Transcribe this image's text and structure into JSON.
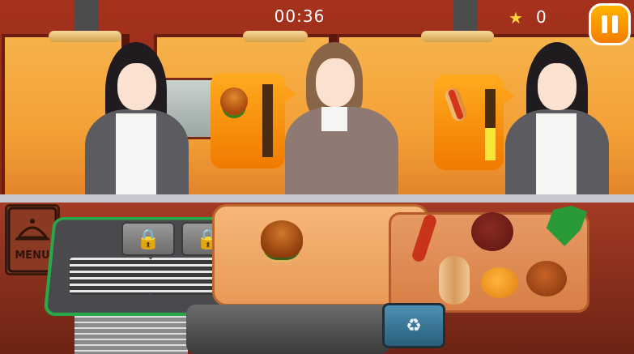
{
  "hud": {
    "timer": "00:36",
    "score": "0",
    "star_icon": "star-icon",
    "pause_icon": "pause-icon"
  },
  "menu": {
    "label": "MENU",
    "icon": "cloche-icon"
  },
  "orders": [
    {
      "item": "burger",
      "icon": "burger-icon",
      "patience_fraction": 0.0
    },
    {
      "item": "hotdog",
      "icon": "hotdog-icon",
      "patience_fraction": 0.45
    }
  ],
  "grill": {
    "slots": [
      {
        "state": "locked",
        "icon": "lock-icon"
      },
      {
        "state": "locked",
        "icon": "lock-icon"
      }
    ]
  },
  "assembly_board": {
    "item": "burger"
  },
  "ingredients": [
    "sausage",
    "hotdog-bun",
    "patty",
    "bottom-bun",
    "top-bun",
    "lettuce"
  ],
  "trash": {
    "icon": "recycle-icon"
  },
  "colors": {
    "accent_orange": "#f57c00",
    "grill_border": "#29a84a",
    "timer_fill": "#f5e638"
  }
}
